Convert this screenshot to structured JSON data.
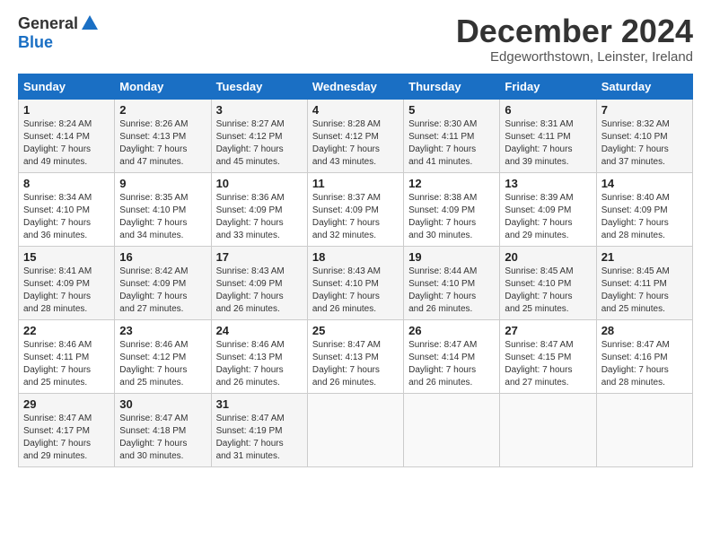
{
  "header": {
    "logo": {
      "general": "General",
      "blue": "Blue"
    },
    "title": "December 2024",
    "subtitle": "Edgeworthstown, Leinster, Ireland"
  },
  "weekdays": [
    "Sunday",
    "Monday",
    "Tuesday",
    "Wednesday",
    "Thursday",
    "Friday",
    "Saturday"
  ],
  "weeks": [
    [
      {
        "day": "1",
        "sunrise": "8:24 AM",
        "sunset": "4:14 PM",
        "daylight": "7 hours and 49 minutes."
      },
      {
        "day": "2",
        "sunrise": "8:26 AM",
        "sunset": "4:13 PM",
        "daylight": "7 hours and 47 minutes."
      },
      {
        "day": "3",
        "sunrise": "8:27 AM",
        "sunset": "4:12 PM",
        "daylight": "7 hours and 45 minutes."
      },
      {
        "day": "4",
        "sunrise": "8:28 AM",
        "sunset": "4:12 PM",
        "daylight": "7 hours and 43 minutes."
      },
      {
        "day": "5",
        "sunrise": "8:30 AM",
        "sunset": "4:11 PM",
        "daylight": "7 hours and 41 minutes."
      },
      {
        "day": "6",
        "sunrise": "8:31 AM",
        "sunset": "4:11 PM",
        "daylight": "7 hours and 39 minutes."
      },
      {
        "day": "7",
        "sunrise": "8:32 AM",
        "sunset": "4:10 PM",
        "daylight": "7 hours and 37 minutes."
      }
    ],
    [
      {
        "day": "8",
        "sunrise": "8:34 AM",
        "sunset": "4:10 PM",
        "daylight": "7 hours and 36 minutes."
      },
      {
        "day": "9",
        "sunrise": "8:35 AM",
        "sunset": "4:10 PM",
        "daylight": "7 hours and 34 minutes."
      },
      {
        "day": "10",
        "sunrise": "8:36 AM",
        "sunset": "4:09 PM",
        "daylight": "7 hours and 33 minutes."
      },
      {
        "day": "11",
        "sunrise": "8:37 AM",
        "sunset": "4:09 PM",
        "daylight": "7 hours and 32 minutes."
      },
      {
        "day": "12",
        "sunrise": "8:38 AM",
        "sunset": "4:09 PM",
        "daylight": "7 hours and 30 minutes."
      },
      {
        "day": "13",
        "sunrise": "8:39 AM",
        "sunset": "4:09 PM",
        "daylight": "7 hours and 29 minutes."
      },
      {
        "day": "14",
        "sunrise": "8:40 AM",
        "sunset": "4:09 PM",
        "daylight": "7 hours and 28 minutes."
      }
    ],
    [
      {
        "day": "15",
        "sunrise": "8:41 AM",
        "sunset": "4:09 PM",
        "daylight": "7 hours and 28 minutes."
      },
      {
        "day": "16",
        "sunrise": "8:42 AM",
        "sunset": "4:09 PM",
        "daylight": "7 hours and 27 minutes."
      },
      {
        "day": "17",
        "sunrise": "8:43 AM",
        "sunset": "4:09 PM",
        "daylight": "7 hours and 26 minutes."
      },
      {
        "day": "18",
        "sunrise": "8:43 AM",
        "sunset": "4:10 PM",
        "daylight": "7 hours and 26 minutes."
      },
      {
        "day": "19",
        "sunrise": "8:44 AM",
        "sunset": "4:10 PM",
        "daylight": "7 hours and 26 minutes."
      },
      {
        "day": "20",
        "sunrise": "8:45 AM",
        "sunset": "4:10 PM",
        "daylight": "7 hours and 25 minutes."
      },
      {
        "day": "21",
        "sunrise": "8:45 AM",
        "sunset": "4:11 PM",
        "daylight": "7 hours and 25 minutes."
      }
    ],
    [
      {
        "day": "22",
        "sunrise": "8:46 AM",
        "sunset": "4:11 PM",
        "daylight": "7 hours and 25 minutes."
      },
      {
        "day": "23",
        "sunrise": "8:46 AM",
        "sunset": "4:12 PM",
        "daylight": "7 hours and 25 minutes."
      },
      {
        "day": "24",
        "sunrise": "8:46 AM",
        "sunset": "4:13 PM",
        "daylight": "7 hours and 26 minutes."
      },
      {
        "day": "25",
        "sunrise": "8:47 AM",
        "sunset": "4:13 PM",
        "daylight": "7 hours and 26 minutes."
      },
      {
        "day": "26",
        "sunrise": "8:47 AM",
        "sunset": "4:14 PM",
        "daylight": "7 hours and 26 minutes."
      },
      {
        "day": "27",
        "sunrise": "8:47 AM",
        "sunset": "4:15 PM",
        "daylight": "7 hours and 27 minutes."
      },
      {
        "day": "28",
        "sunrise": "8:47 AM",
        "sunset": "4:16 PM",
        "daylight": "7 hours and 28 minutes."
      }
    ],
    [
      {
        "day": "29",
        "sunrise": "8:47 AM",
        "sunset": "4:17 PM",
        "daylight": "7 hours and 29 minutes."
      },
      {
        "day": "30",
        "sunrise": "8:47 AM",
        "sunset": "4:18 PM",
        "daylight": "7 hours and 30 minutes."
      },
      {
        "day": "31",
        "sunrise": "8:47 AM",
        "sunset": "4:19 PM",
        "daylight": "7 hours and 31 minutes."
      },
      null,
      null,
      null,
      null
    ]
  ],
  "labels": {
    "sunrise": "Sunrise:",
    "sunset": "Sunset:",
    "daylight": "Daylight:"
  }
}
